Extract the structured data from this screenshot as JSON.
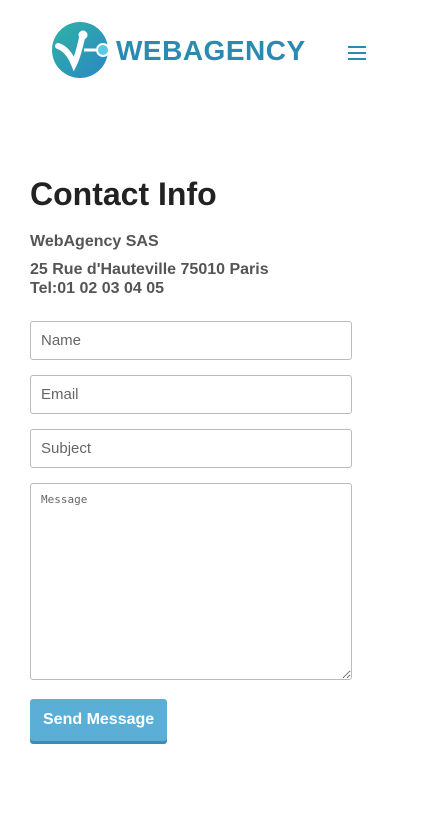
{
  "header": {
    "logo_text": "WEBAGENCY",
    "logo_icon": "logo-mark-icon",
    "menu_icon": "hamburger-menu-icon",
    "brand_color": "#2a8ab0"
  },
  "main": {
    "title": "Contact Info",
    "company": "WebAgency SAS",
    "address": "25 Rue d'Hauteville 75010 Paris",
    "phone": "Tel:01 02 03 04 05"
  },
  "form": {
    "name_placeholder": "Name",
    "email_placeholder": "Email",
    "subject_placeholder": "Subject",
    "message_placeholder": "Message",
    "send_label": "Send Message",
    "button_color": "#5bafd6"
  }
}
